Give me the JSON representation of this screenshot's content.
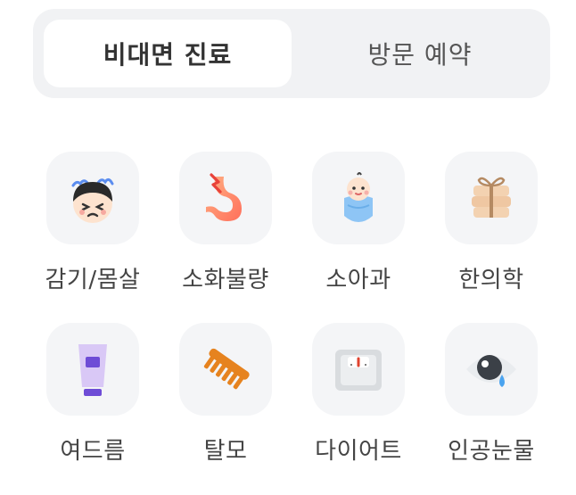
{
  "tabs": [
    {
      "label": "비대면 진료",
      "active": true
    },
    {
      "label": "방문 예약",
      "active": false
    }
  ],
  "categories": [
    {
      "label": "감기/몸살",
      "icon": "sick-face-icon"
    },
    {
      "label": "소화불량",
      "icon": "stomach-icon"
    },
    {
      "label": "소아과",
      "icon": "baby-icon"
    },
    {
      "label": "한의학",
      "icon": "herbal-medicine-icon"
    },
    {
      "label": "여드름",
      "icon": "cream-tube-icon"
    },
    {
      "label": "탈모",
      "icon": "comb-icon"
    },
    {
      "label": "다이어트",
      "icon": "scale-icon"
    },
    {
      "label": "인공눈물",
      "icon": "eye-drop-icon"
    }
  ],
  "colors": {
    "segment_bg": "#f1f2f4",
    "tile_bg": "#f4f5f7",
    "text": "#444444"
  }
}
